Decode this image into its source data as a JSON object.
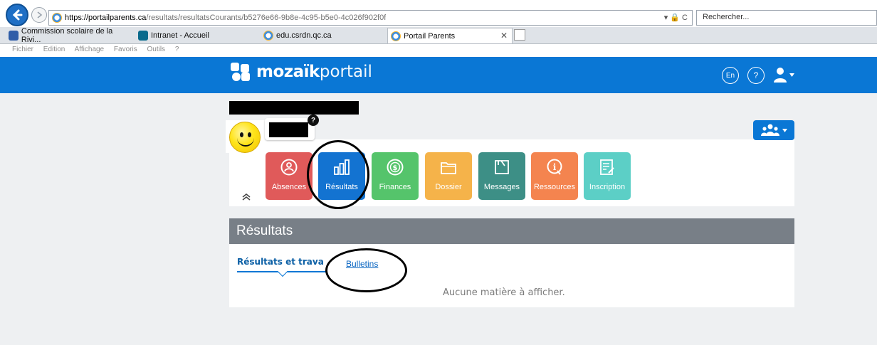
{
  "browser": {
    "url_host": "https://portailparents.ca",
    "url_path": "/resultats/resultatsCourants/b5276e66-9b8e-4c95-b5e0-4c026f902f0f",
    "url_controls": "▾ 🔒 C",
    "search_placeholder": "Rechercher...",
    "tabs": [
      {
        "label": "Commission scolaire de la Rivi...",
        "icon": "csrdn-favicon"
      },
      {
        "label": "Intranet - Accueil",
        "icon": "sharepoint-icon"
      },
      {
        "label": "edu.csrdn.qc.ca",
        "icon": "ie-icon"
      },
      {
        "label": "Portail Parents",
        "icon": "ie-icon",
        "active": true
      }
    ],
    "close_tab": "✕",
    "menu": [
      "Fichier",
      "Edition",
      "Affichage",
      "Favoris",
      "Outils",
      "?"
    ]
  },
  "header": {
    "logo_bold": "mozaïk",
    "logo_light": "portail",
    "lang_button": "En",
    "help_button": "?"
  },
  "student": {
    "help_badge": "?"
  },
  "tiles": [
    {
      "label": "Absences",
      "color": "#e05a5a",
      "icon": "absences-icon"
    },
    {
      "label": "Résultats",
      "color": "#1373d1",
      "icon": "bar-chart-icon"
    },
    {
      "label": "Finances",
      "color": "#55c46b",
      "icon": "dollar-icon"
    },
    {
      "label": "Dossier",
      "color": "#f5b34a",
      "icon": "folder-icon"
    },
    {
      "label": "Messages",
      "color": "#3d8f86",
      "icon": "message-icon"
    },
    {
      "label": "Ressources",
      "color": "#f4844f",
      "icon": "resources-icon"
    },
    {
      "label": "Inscription",
      "color": "#5ccfc6",
      "icon": "form-icon"
    }
  ],
  "section": {
    "title": "Résultats",
    "subtabs": [
      "Résultats et travaux",
      "Bulletins"
    ],
    "empty_message": "Aucune matière à afficher."
  },
  "colors": {
    "brand_blue": "#0a77d5",
    "section_gray": "#787f87",
    "page_bg": "#eef0f2"
  }
}
